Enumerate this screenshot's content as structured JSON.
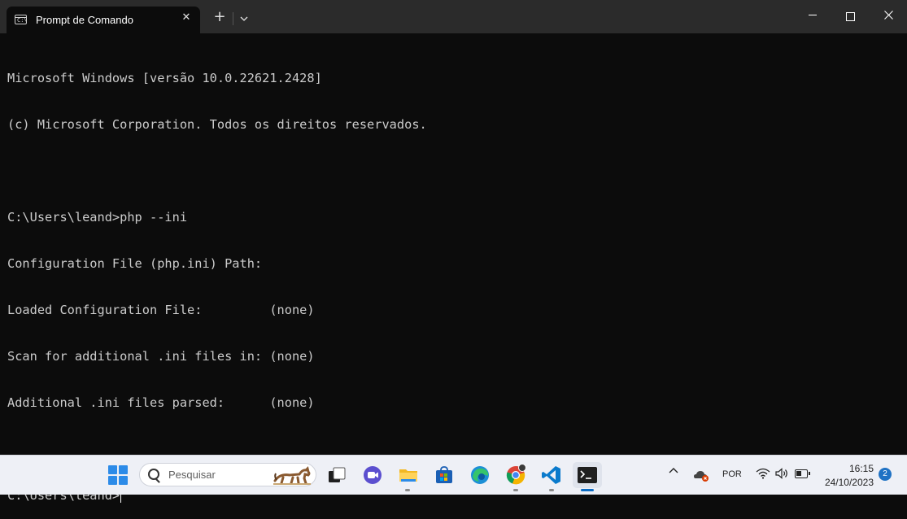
{
  "window": {
    "tab_title": "Prompt de Comando",
    "tab_icon": "cmd-icon",
    "close_tab_glyph": "✕",
    "new_tab_glyph": "+",
    "dropdown_glyph": "⌄",
    "minimize_glyph": "—",
    "close_glyph": "✕"
  },
  "terminal": {
    "lines": [
      "Microsoft Windows [versão 10.0.22621.2428]",
      "(c) Microsoft Corporation. Todos os direitos reservados.",
      "",
      "C:\\Users\\leand>php --ini",
      "Configuration File (php.ini) Path:",
      "Loaded Configuration File:         (none)",
      "Scan for additional .ini files in: (none)",
      "Additional .ini files parsed:      (none)",
      "",
      "C:\\Users\\leand>"
    ]
  },
  "taskbar": {
    "search_placeholder": "Pesquisar",
    "apps": [
      "start-icon",
      "task-view-icon",
      "meet-icon",
      "file-explorer-icon",
      "store-icon",
      "edge-icon",
      "chrome-icon",
      "vscode-icon",
      "terminal-icon"
    ],
    "tray": {
      "language": "POR",
      "time": "16:15",
      "date": "24/10/2023",
      "notification_count": "2"
    },
    "colors": {
      "accent": "#0b6cc4",
      "terminal_bg": "#0c0c0c",
      "terminal_fg": "#cccccc"
    }
  }
}
